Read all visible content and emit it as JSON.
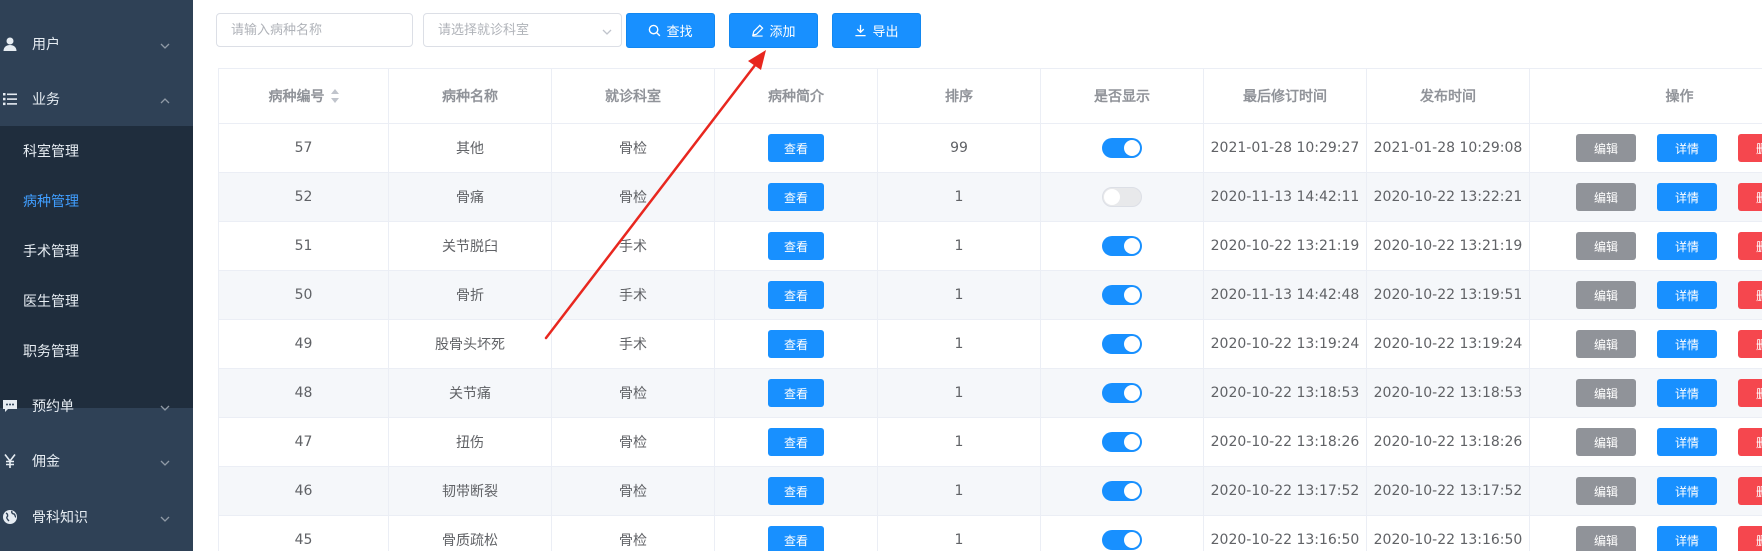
{
  "sidebar": {
    "menus": [
      {
        "label": "用户",
        "icon": "user-icon",
        "expanded": false
      },
      {
        "label": "业务",
        "icon": "list-icon",
        "expanded": true
      },
      {
        "label": "预约单",
        "icon": "chat-icon",
        "expanded": false
      },
      {
        "label": "佣金",
        "icon": "yen-icon",
        "expanded": false
      },
      {
        "label": "骨科知识",
        "icon": "globe-icon",
        "expanded": false
      }
    ],
    "submenu": [
      {
        "label": "科室管理",
        "active": false
      },
      {
        "label": "病种管理",
        "active": true
      },
      {
        "label": "手术管理",
        "active": false
      },
      {
        "label": "医生管理",
        "active": false
      },
      {
        "label": "职务管理",
        "active": false
      }
    ]
  },
  "toolbar": {
    "name_placeholder": "请输入病种名称",
    "dept_placeholder": "请选择就诊科室",
    "search_label": "查找",
    "add_label": "添加",
    "export_label": "导出"
  },
  "table": {
    "headers": [
      "病种编号",
      "病种名称",
      "就诊科室",
      "病种简介",
      "排序",
      "是否显示",
      "最后修订时间",
      "发布时间",
      "操作"
    ],
    "view_label": "查看",
    "edit_label": "编辑",
    "detail_label": "详情",
    "delete_label": "删除",
    "rows": [
      {
        "id": "57",
        "name": "其他",
        "dept": "骨检",
        "order": "99",
        "shown": true,
        "modified": "2021-01-28 10:29:27",
        "published": "2021-01-28 10:29:08"
      },
      {
        "id": "52",
        "name": "骨痛",
        "dept": "骨检",
        "order": "1",
        "shown": false,
        "modified": "2020-11-13 14:42:11",
        "published": "2020-10-22 13:22:21"
      },
      {
        "id": "51",
        "name": "关节脱臼",
        "dept": "手术",
        "order": "1",
        "shown": true,
        "modified": "2020-10-22 13:21:19",
        "published": "2020-10-22 13:21:19"
      },
      {
        "id": "50",
        "name": "骨折",
        "dept": "手术",
        "order": "1",
        "shown": true,
        "modified": "2020-11-13 14:42:48",
        "published": "2020-10-22 13:19:51"
      },
      {
        "id": "49",
        "name": "股骨头坏死",
        "dept": "手术",
        "order": "1",
        "shown": true,
        "modified": "2020-10-22 13:19:24",
        "published": "2020-10-22 13:19:24"
      },
      {
        "id": "48",
        "name": "关节痛",
        "dept": "骨检",
        "order": "1",
        "shown": true,
        "modified": "2020-10-22 13:18:53",
        "published": "2020-10-22 13:18:53"
      },
      {
        "id": "47",
        "name": "扭伤",
        "dept": "骨检",
        "order": "1",
        "shown": true,
        "modified": "2020-10-22 13:18:26",
        "published": "2020-10-22 13:18:26"
      },
      {
        "id": "46",
        "name": "韧带断裂",
        "dept": "骨检",
        "order": "1",
        "shown": true,
        "modified": "2020-10-22 13:17:52",
        "published": "2020-10-22 13:17:52"
      },
      {
        "id": "45",
        "name": "骨质疏松",
        "dept": "骨检",
        "order": "1",
        "shown": true,
        "modified": "2020-10-22 13:16:50",
        "published": "2020-10-22 13:16:50"
      }
    ]
  },
  "colors": {
    "sidebar_bg": "#2f4156",
    "submenu_bg": "#1f2d3d",
    "primary": "#1890ff",
    "edit": "#909399",
    "danger": "#f5474e",
    "annotation_arrow": "#e8271f"
  }
}
